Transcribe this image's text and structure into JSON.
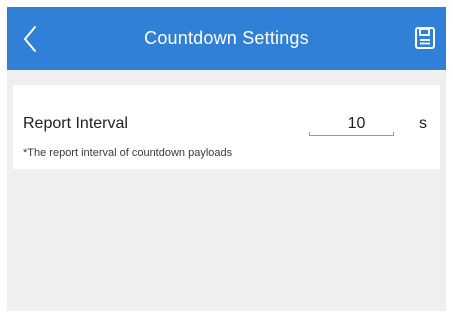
{
  "header": {
    "title": "Countdown Settings",
    "back_icon": "chevron-left-icon",
    "save_icon": "save-icon",
    "background_color": "#2f80d6"
  },
  "settings": {
    "report_interval": {
      "label": "Report Interval",
      "value": "10",
      "unit": "s",
      "hint": "*The report interval of countdown payloads"
    }
  },
  "colors": {
    "page_background": "#efefef",
    "card_background": "#ffffff"
  }
}
